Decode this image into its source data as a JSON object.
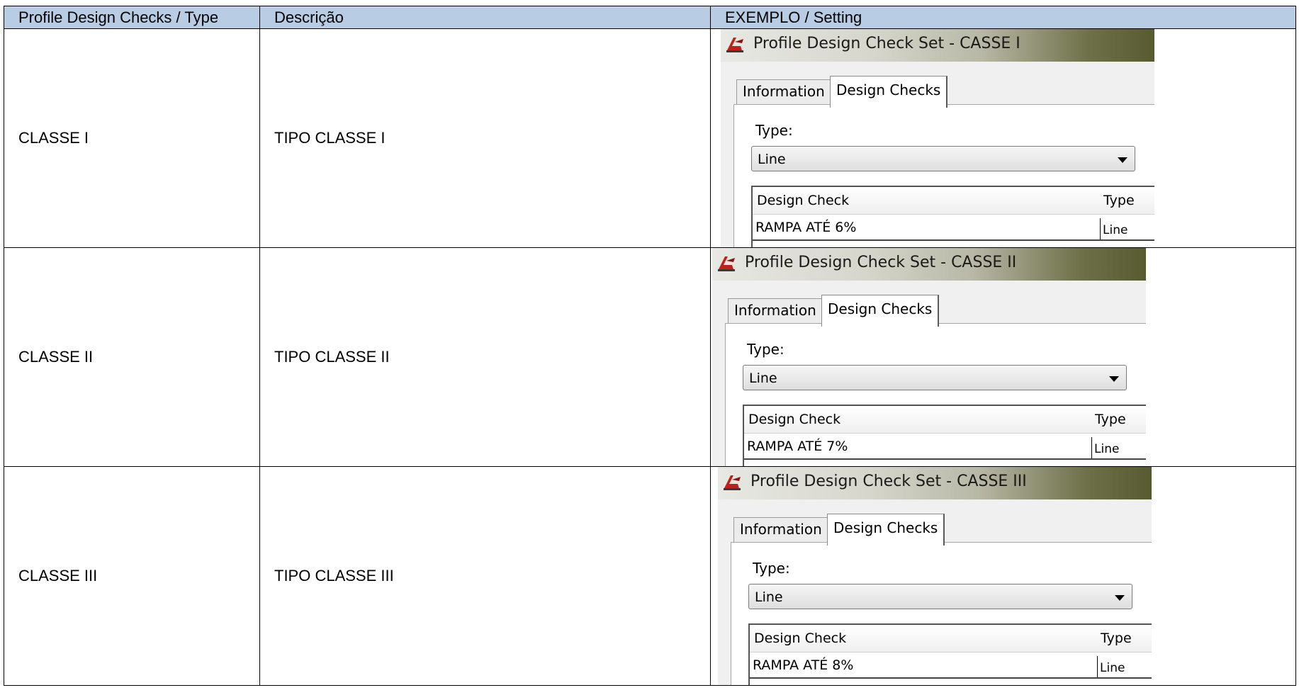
{
  "headers": {
    "col1": "Profile Design Checks / Type",
    "col2": "Descrição",
    "col3": "EXEMPLO / Setting"
  },
  "rows": [
    {
      "type": "CLASSE I",
      "description": "TIPO CLASSE I",
      "example": {
        "window_title": "Profile Design Check Set - CASSE I",
        "tab_information": "Information",
        "tab_design_checks": "Design Checks",
        "type_label": "Type:",
        "type_value": "Line",
        "grid_header_check": "Design Check",
        "grid_header_type": "Type",
        "grid_row_check": "RAMPA ATÉ 6%",
        "grid_row_type": "Line",
        "icon": "civil3d-app-icon"
      }
    },
    {
      "type": "CLASSE II",
      "description": "TIPO CLASSE II",
      "example": {
        "window_title": "Profile Design Check Set - CASSE II",
        "tab_information": "Information",
        "tab_design_checks": "Design Checks",
        "type_label": "Type:",
        "type_value": "Line",
        "grid_header_check": "Design Check",
        "grid_header_type": "Type",
        "grid_row_check": "RAMPA ATÉ 7%",
        "grid_row_type": "Line",
        "icon": "civil3d-app-icon"
      }
    },
    {
      "type": "CLASSE III",
      "description": "TIPO CLASSE III",
      "example": {
        "window_title": "Profile Design Check Set - CASSE III",
        "tab_information": "Information",
        "tab_design_checks": "Design Checks",
        "type_label": "Type:",
        "type_value": "Line",
        "grid_header_check": "Design Check",
        "grid_header_type": "Type",
        "grid_row_check": "RAMPA ATÉ 8%",
        "grid_row_type": "Line",
        "icon": "civil3d-app-icon"
      }
    }
  ],
  "colors": {
    "header_bg": "#b8cce4",
    "border": "#000000"
  }
}
